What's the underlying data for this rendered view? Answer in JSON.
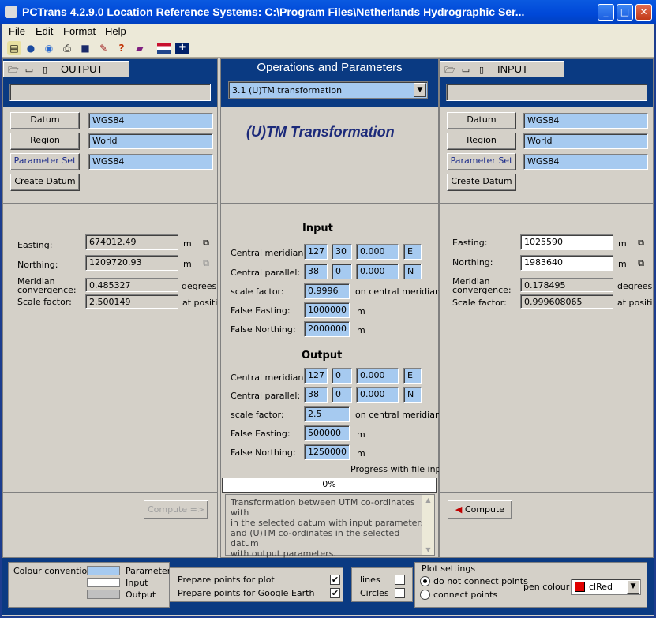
{
  "title": "PCTrans 4.2.9.0    Location Reference Systems: C:\\Program Files\\Netherlands Hydrographic Ser...",
  "window_controls": {
    "minimize": "_",
    "maximize": "□",
    "close": "✕"
  },
  "menu": [
    "File",
    "Edit",
    "Format",
    "Help"
  ],
  "toolbar_icons": [
    "open-icon",
    "globe-icon",
    "earth-icon",
    "print-icon",
    "save-icon",
    "tools-icon",
    "help-icon",
    "book-icon",
    "flag-nl-icon",
    "flag-uk-icon"
  ],
  "output_panel": {
    "tab_label": "OUTPUT",
    "path_value": "",
    "datum_button": "Datum",
    "datum_value": "WGS84",
    "region_button": "Region",
    "region_value": "World",
    "paramset_button": "Parameter Set",
    "paramset_value": "WGS84",
    "create_datum_button": "Create Datum",
    "easting_label": "Easting:",
    "easting_value": "674012.49",
    "easting_unit": "m",
    "northing_label": "Northing:",
    "northing_value": "1209720.93",
    "northing_unit": "m",
    "meridian_label_1": "Meridian",
    "meridian_label_2": "convergence:",
    "meridian_value": "0.485327",
    "meridian_unit": "degrees",
    "scale_label": "Scale factor:",
    "scale_value": "2.500149",
    "scale_unit": "at positio",
    "compute_button": "Compute =>"
  },
  "operations_panel": {
    "header": "Operations and Parameters",
    "operation_selected": "3.1   (U)TM transformation",
    "big_title": "(U)TM Transformation",
    "input_heading": "Input",
    "output_heading": "Output",
    "labels": {
      "central_meridian": "Central meridian:",
      "central_parallel": "Central parallel:",
      "scale_factor": "scale factor:",
      "false_easting": "False Easting:",
      "false_northing": "False Northing:",
      "on_central_meridian": "on central meridian",
      "m": "m"
    },
    "input": {
      "cm_deg": "127",
      "cm_min": "30",
      "cm_sec": "0.000",
      "cm_hemi": "E",
      "cp_deg": "38",
      "cp_min": "0",
      "cp_sec": "0.000",
      "cp_hemi": "N",
      "scale": "0.9996",
      "false_easting": "1000000",
      "false_northing": "2000000"
    },
    "output": {
      "cm_deg": "127",
      "cm_min": "0",
      "cm_sec": "0.000",
      "cm_hemi": "E",
      "cp_deg": "38",
      "cp_min": "0",
      "cp_sec": "0.000",
      "cp_hemi": "N",
      "scale": "2.5",
      "false_easting": "500000",
      "false_northing": "1250000"
    },
    "progress_label": "Progress with file input",
    "progress_value": "0%",
    "description_lines": [
      "Transformation between UTM co-ordinates with",
      "in the selected datum with input parameters",
      "and (U)TM co-ordinates in the selected datum",
      "with output parameters."
    ]
  },
  "input_panel": {
    "tab_label": "INPUT",
    "path_value": "",
    "datum_button": "Datum",
    "datum_value": "WGS84",
    "region_button": "Region",
    "region_value": "World",
    "paramset_button": "Parameter Set",
    "paramset_value": "WGS84",
    "create_datum_button": "Create Datum",
    "easting_label": "Easting:",
    "easting_value": "1025590",
    "easting_unit": "m",
    "northing_label": "Northing:",
    "northing_value": "1983640",
    "northing_unit": "m",
    "meridian_label_1": "Meridian",
    "meridian_label_2": "convergence:",
    "meridian_value": "0.178495",
    "meridian_unit": "degrees",
    "scale_label": "Scale factor:",
    "scale_value": "0.999608065",
    "scale_unit": "at positio",
    "compute_button": "Compute"
  },
  "bottom": {
    "colour_conventions": "Colour conventions",
    "legend": [
      {
        "label": "Parameters",
        "color": "#a6caf0"
      },
      {
        "label": "Input",
        "color": "#ffffff"
      },
      {
        "label": "Output",
        "color": "#c0c0c0"
      }
    ],
    "prepare_plot": "Prepare points for plot",
    "prepare_plot_checked": true,
    "prepare_google": "Prepare points for Google Earth",
    "prepare_google_checked": true,
    "lines": "lines",
    "circles": "Circles",
    "plot_settings": "Plot settings",
    "radio_no_connect": "do not connect points",
    "radio_connect": "connect points",
    "radio_selected": "do not connect points",
    "pen_colour_label": "pen colour",
    "pen_colour_value": "clRed",
    "pen_colour_hex": "#e00000"
  }
}
